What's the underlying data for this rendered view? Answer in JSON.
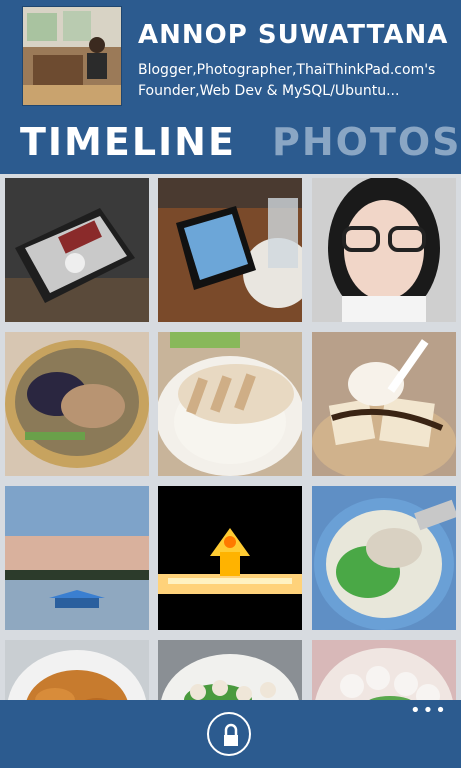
{
  "profile": {
    "name": "ANNOP SUWATTANA",
    "bio": "Blogger,Photographer,ThaiThinkPad.com's Founder,Web Dev & MySQL/Ubuntu..."
  },
  "pivot": {
    "tabs": [
      "TIMELINE",
      "PHOTOS"
    ]
  },
  "appbar": {
    "more_label": "•••",
    "lock_icon": "lock-icon"
  },
  "colors": {
    "accent": "#2c5b8f",
    "inactive_tab": "#8aa6c4",
    "grid_bg": "#d7dbe0"
  }
}
